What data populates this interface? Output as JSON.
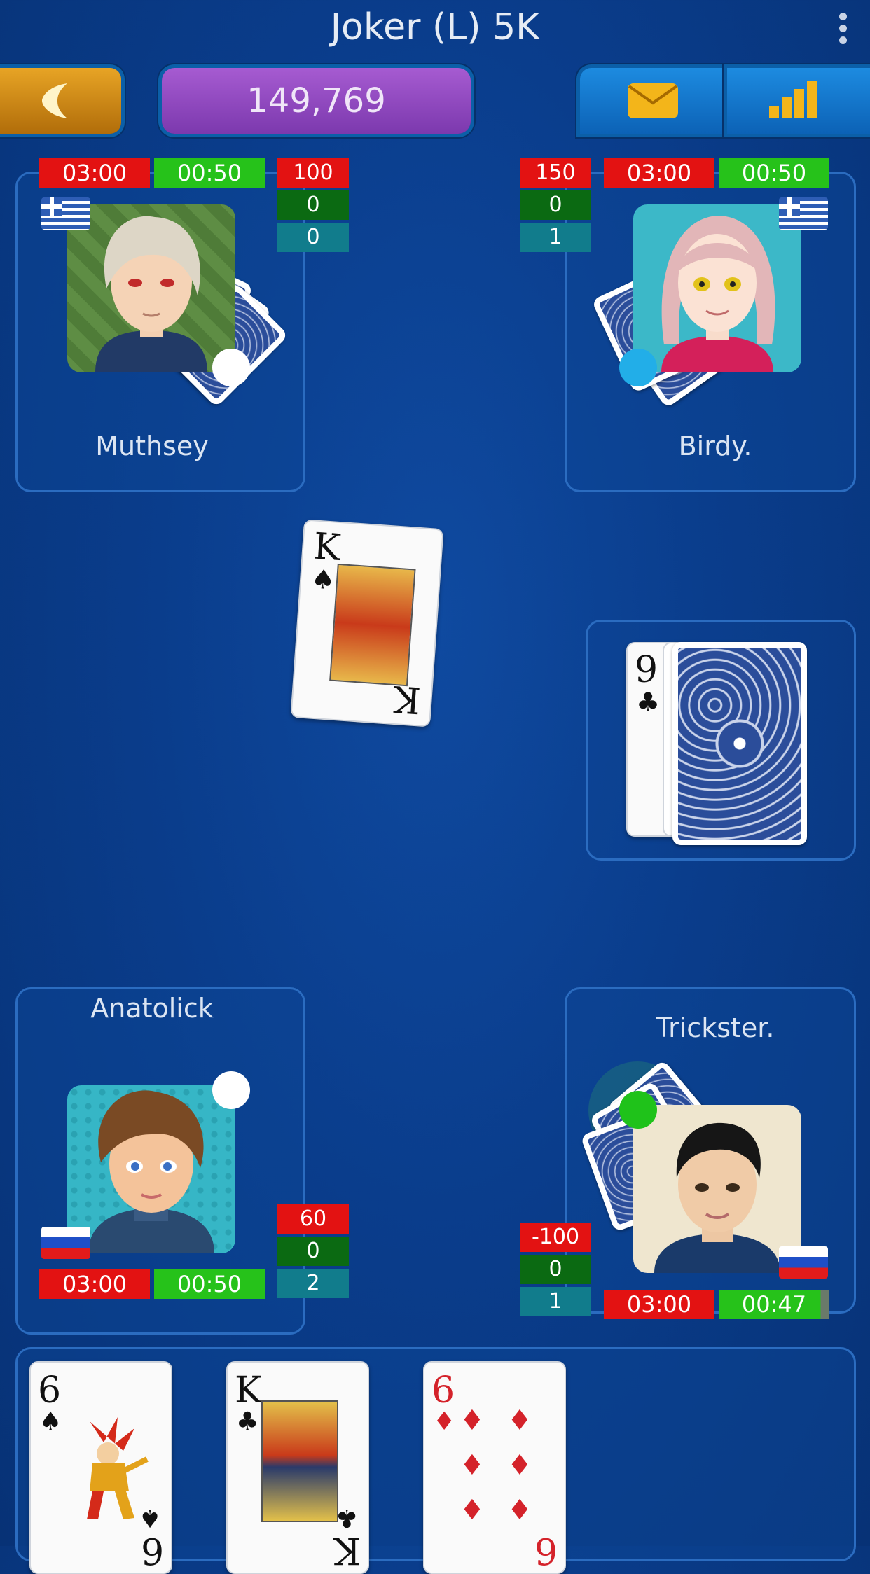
{
  "header": {
    "title": "Joker (L) 5K",
    "balance": "149,769"
  },
  "players": {
    "top_left": {
      "name": "Muthsey",
      "timer_total": "03:00",
      "timer_turn": "00:50",
      "bid": "100",
      "taken": "0",
      "score": "0",
      "flag": "greece"
    },
    "top_right": {
      "name": "Birdy.",
      "timer_total": "03:00",
      "timer_turn": "00:50",
      "bid": "150",
      "taken": "0",
      "score": "1",
      "flag": "greece"
    },
    "bottom_left": {
      "name": "Anatolick",
      "timer_total": "03:00",
      "timer_turn": "00:50",
      "bid": "60",
      "taken": "0",
      "score": "2",
      "flag": "russia"
    },
    "bottom_right": {
      "name": "Trickster.",
      "timer_total": "03:00",
      "timer_turn": "00:47",
      "bid": "-100",
      "taken": "0",
      "score": "1",
      "flag": "russia"
    }
  },
  "table": {
    "played_card": {
      "rank": "K",
      "suit": "♠"
    },
    "trump_card": {
      "rank": "9",
      "suit": "♣"
    }
  },
  "hand": [
    {
      "rank": "6",
      "suit": "♠",
      "label": "joker",
      "color": "#111111"
    },
    {
      "rank": "K",
      "suit": "♣",
      "label": "king",
      "color": "#111111"
    },
    {
      "rank": "6",
      "suit": "♦",
      "label": "six",
      "color": "#d4222a"
    }
  ]
}
